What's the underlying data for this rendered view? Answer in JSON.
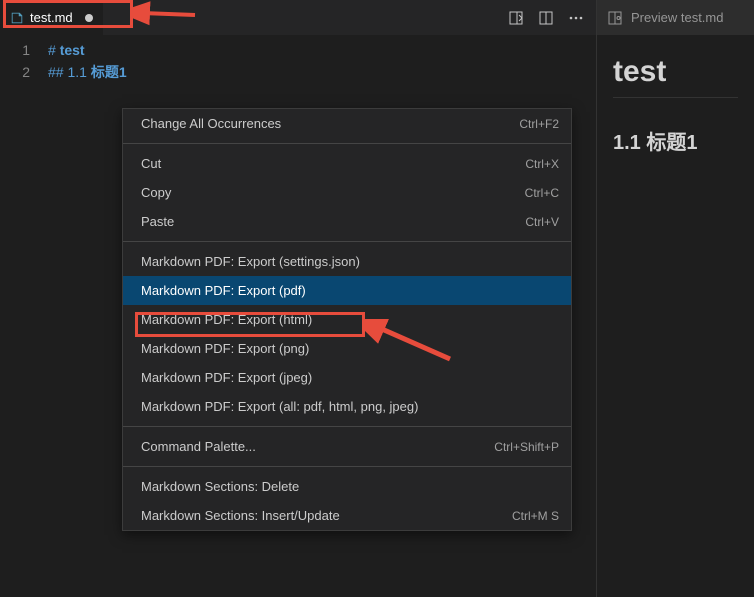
{
  "editor": {
    "tab": {
      "filename": "test.md"
    },
    "gutter": [
      "1",
      "2"
    ],
    "lines": {
      "l1_hash": "#",
      "l1_text": "test",
      "l2_hash": "##",
      "l2_num": "1.1",
      "l2_text": "标题1"
    }
  },
  "preview": {
    "tabLabel": "Preview test.md",
    "h1": "test",
    "h2": "1.1 标题1"
  },
  "contextMenu": {
    "items": [
      {
        "label": "Change All Occurrences",
        "shortcut": "Ctrl+F2"
      },
      {
        "label": "Cut",
        "shortcut": "Ctrl+X"
      },
      {
        "label": "Copy",
        "shortcut": "Ctrl+C"
      },
      {
        "label": "Paste",
        "shortcut": "Ctrl+V"
      },
      {
        "label": "Markdown PDF: Export (settings.json)",
        "shortcut": ""
      },
      {
        "label": "Markdown PDF: Export (pdf)",
        "shortcut": ""
      },
      {
        "label": "Markdown PDF: Export (html)",
        "shortcut": ""
      },
      {
        "label": "Markdown PDF: Export (png)",
        "shortcut": ""
      },
      {
        "label": "Markdown PDF: Export (jpeg)",
        "shortcut": ""
      },
      {
        "label": "Markdown PDF: Export (all: pdf, html, png, jpeg)",
        "shortcut": ""
      },
      {
        "label": "Command Palette...",
        "shortcut": "Ctrl+Shift+P"
      },
      {
        "label": "Markdown Sections: Delete",
        "shortcut": ""
      },
      {
        "label": "Markdown Sections: Insert/Update",
        "shortcut": "Ctrl+M S"
      }
    ]
  }
}
